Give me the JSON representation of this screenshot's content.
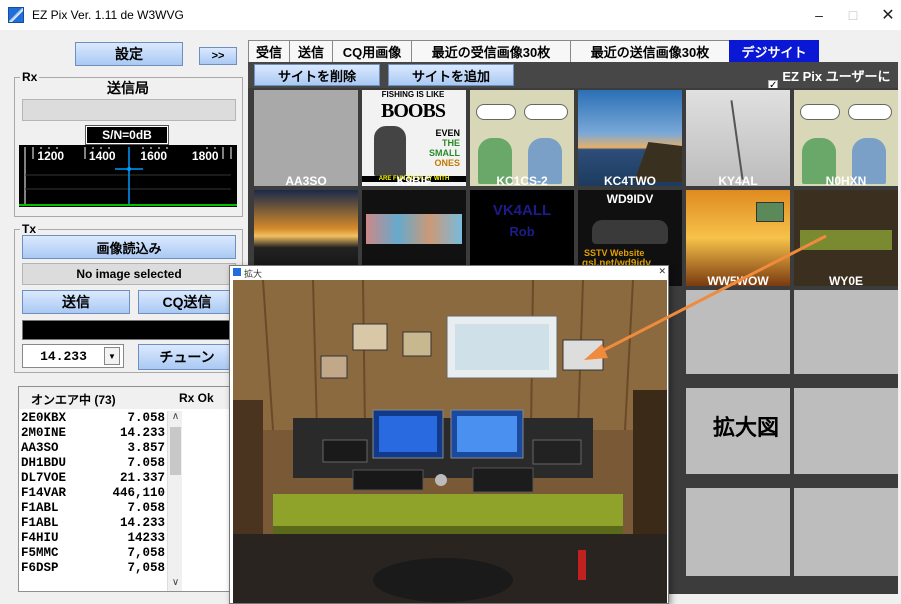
{
  "window": {
    "title": "EZ Pix   Ver. 1.11 de W3WVG",
    "min": "–",
    "max": "□",
    "close": "✕"
  },
  "left": {
    "settings_label": "設定",
    "expand_label": ">>",
    "rx": {
      "group_label": "Rx",
      "station_heading": "送信局",
      "station_value": "",
      "sn_label": "S/N=0dB",
      "freq_ticks": [
        "1200",
        "1400",
        "1600",
        "1800"
      ]
    },
    "tx": {
      "group_label": "Tx",
      "load_image_label": "画像読込み",
      "no_image_label": "No image selected",
      "send_label": "送信",
      "cq_send_label": "CQ送信",
      "frequency_value": "14.233",
      "tune_label": "チューン"
    },
    "onair": {
      "heading": "オンエア中 (73)",
      "rx_ok": "Rx Ok",
      "stations": [
        {
          "call": "2E0KBX",
          "freq": "7.058"
        },
        {
          "call": "2M0INE",
          "freq": "14.233"
        },
        {
          "call": "AA3SO",
          "freq": "3.857"
        },
        {
          "call": "DH1BDU",
          "freq": "7.058"
        },
        {
          "call": "DL7VOE",
          "freq": "21.337"
        },
        {
          "call": "F14VAR",
          "freq": "446,110"
        },
        {
          "call": "F1ABL",
          "freq": "7.058"
        },
        {
          "call": "F1ABL",
          "freq": "14.233"
        },
        {
          "call": "F4HIU",
          "freq": "14233"
        },
        {
          "call": "F5MMC",
          "freq": "7,058"
        },
        {
          "call": "F6DSP",
          "freq": "7,058"
        }
      ]
    }
  },
  "tabs": [
    "受信",
    "送信",
    "CQ用画像",
    "最近の受信画像30枚",
    "最近の送信画像30枚",
    "デジサイト"
  ],
  "toolbar": {
    "delete_site_label": "サイトを削除",
    "add_site_label": "サイトを追加",
    "checkbox_mark": "✓",
    "ez_only_label": "EZ Pix ユーザーに限る"
  },
  "grid": {
    "row1": [
      "AA3SO",
      "K9BIF",
      "KC1CS-2",
      "KC4TWO",
      "KY4AL",
      "N0HXN"
    ],
    "row2_visible": [
      "WW5WOW",
      "WY0E"
    ],
    "thumb_texts": {
      "k9bif": [
        "FISHING IS LIKE",
        "BOOBS",
        "EVEN",
        "THE",
        "SMALL",
        "ONES",
        "ARE FUN TO PLAY WITH"
      ],
      "vk4all": [
        "VK4ALL",
        "Rob"
      ],
      "wd9idv": [
        "WD9IDV",
        "SSTV Website",
        "qsl.net/wd9idv"
      ]
    }
  },
  "popup": {
    "title": "拡大"
  },
  "annotation": "拡大図",
  "colors": {
    "tab_active": "#0a18d6",
    "toolbar": "#474747",
    "grid_bg": "#3c3c3c",
    "arrow": "#f08a3c"
  }
}
